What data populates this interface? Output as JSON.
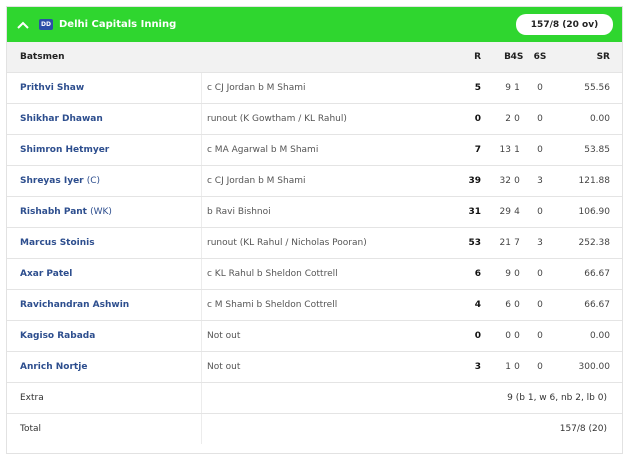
{
  "header": {
    "team_logo_text": "DD",
    "team_name": "Delhi Capitals Inning",
    "score": "157/8 (20 ov)",
    "color": "#2fd62f"
  },
  "columns": {
    "batsmen": "Batsmen",
    "r": "R",
    "b": "B",
    "fours": "4S",
    "sixes": "6S",
    "sr": "SR"
  },
  "rows": [
    {
      "name": "Prithvi Shaw",
      "role": "",
      "dismissal": "c CJ Jordan b M Shami",
      "r": "5",
      "b": "9",
      "fours": "1",
      "sixes": "0",
      "sr": "55.56"
    },
    {
      "name": "Shikhar Dhawan",
      "role": "",
      "dismissal": "runout (K Gowtham / KL Rahul)",
      "r": "0",
      "b": "2",
      "fours": "0",
      "sixes": "0",
      "sr": "0.00"
    },
    {
      "name": "Shimron Hetmyer",
      "role": "",
      "dismissal": "c MA Agarwal b M Shami",
      "r": "7",
      "b": "13",
      "fours": "1",
      "sixes": "0",
      "sr": "53.85"
    },
    {
      "name": "Shreyas Iyer",
      "role": "(C)",
      "dismissal": "c CJ Jordan b M Shami",
      "r": "39",
      "b": "32",
      "fours": "0",
      "sixes": "3",
      "sr": "121.88"
    },
    {
      "name": "Rishabh Pant",
      "role": "(WK)",
      "dismissal": "b Ravi Bishnoi",
      "r": "31",
      "b": "29",
      "fours": "4",
      "sixes": "0",
      "sr": "106.90"
    },
    {
      "name": "Marcus Stoinis",
      "role": "",
      "dismissal": "runout (KL Rahul / Nicholas Pooran)",
      "r": "53",
      "b": "21",
      "fours": "7",
      "sixes": "3",
      "sr": "252.38"
    },
    {
      "name": "Axar Patel",
      "role": "",
      "dismissal": "c KL Rahul b Sheldon Cottrell",
      "r": "6",
      "b": "9",
      "fours": "0",
      "sixes": "0",
      "sr": "66.67"
    },
    {
      "name": "Ravichandran Ashwin",
      "role": "",
      "dismissal": "c M Shami b Sheldon Cottrell",
      "r": "4",
      "b": "6",
      "fours": "0",
      "sixes": "0",
      "sr": "66.67"
    },
    {
      "name": "Kagiso Rabada",
      "role": "",
      "dismissal": "Not out",
      "r": "0",
      "b": "0",
      "fours": "0",
      "sixes": "0",
      "sr": "0.00"
    },
    {
      "name": "Anrich Nortje",
      "role": "",
      "dismissal": "Not out",
      "r": "3",
      "b": "1",
      "fours": "0",
      "sixes": "0",
      "sr": "300.00"
    }
  ],
  "extra": {
    "label": "Extra",
    "value": "9 (b 1, w 6, nb 2, lb 0)"
  },
  "total": {
    "label": "Total",
    "value": "157/8 (20)"
  }
}
